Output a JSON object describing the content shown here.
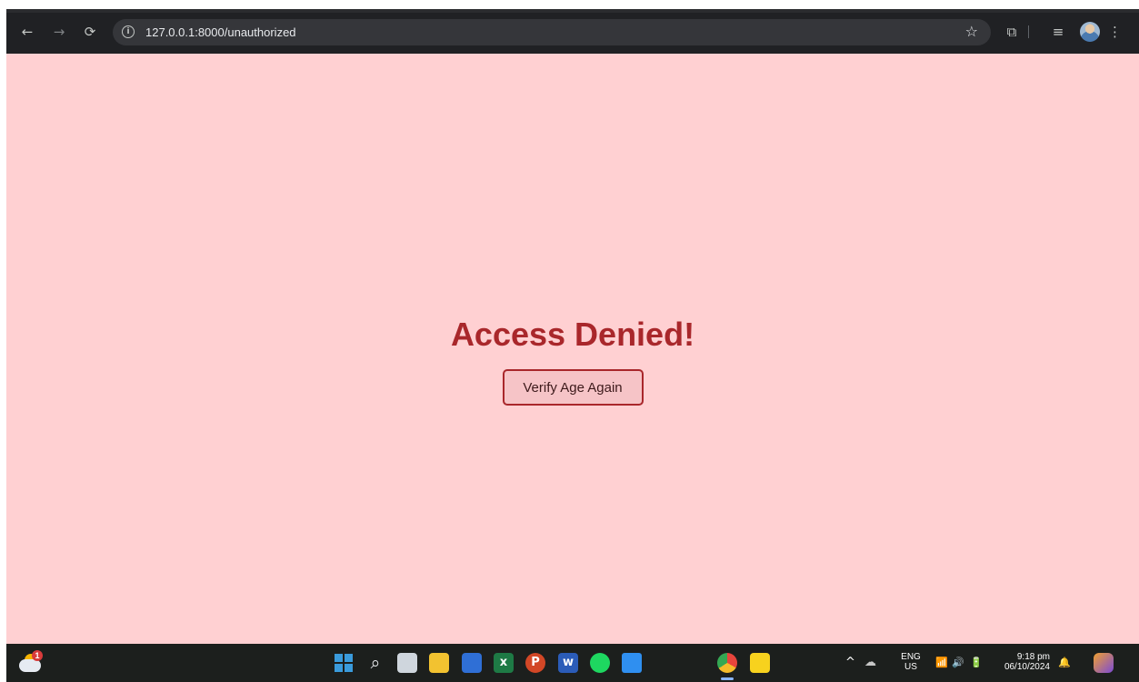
{
  "browser": {
    "url": "127.0.0.1:8000/unauthorized",
    "icons": {
      "back": "←",
      "forward": "→",
      "reload": "⟳",
      "info": "i",
      "star": "☆",
      "extensions": "⧉",
      "media": "≡",
      "menu": "⋮"
    }
  },
  "page": {
    "heading": "Access Denied!",
    "button_label": "Verify Age Again",
    "colors": {
      "background": "#ffd0d2",
      "accent": "#a9272b",
      "button_fill": "#f6c4c7"
    }
  },
  "taskbar": {
    "weather_badge": "1",
    "search_glyph": "⌕",
    "tray": {
      "chevron": "^",
      "lang_line1": "ENG",
      "lang_line2": "US",
      "wifi": "📶",
      "volume": "🔊",
      "battery": "🔋",
      "time": "9:18 pm",
      "date": "06/10/2024",
      "bell": "🔔"
    },
    "apps": [
      {
        "name": "task-view",
        "color": "#cfd6dd"
      },
      {
        "name": "file-explorer",
        "color": "#f2c230"
      },
      {
        "name": "microsoft-store",
        "color": "#2f6fd6"
      },
      {
        "name": "excel",
        "color": "#1e7a45",
        "glyph": "x"
      },
      {
        "name": "powerpoint",
        "color": "#d24726",
        "glyph": "P"
      },
      {
        "name": "word",
        "color": "#2b5cb8",
        "glyph": "w"
      },
      {
        "name": "spotify",
        "color": "#1ed760"
      },
      {
        "name": "vscode",
        "color": "#2f8ff0"
      },
      {
        "name": "chrome",
        "color": "#e8453c"
      },
      {
        "name": "sticky-notes",
        "color": "#f7d21e"
      }
    ]
  }
}
